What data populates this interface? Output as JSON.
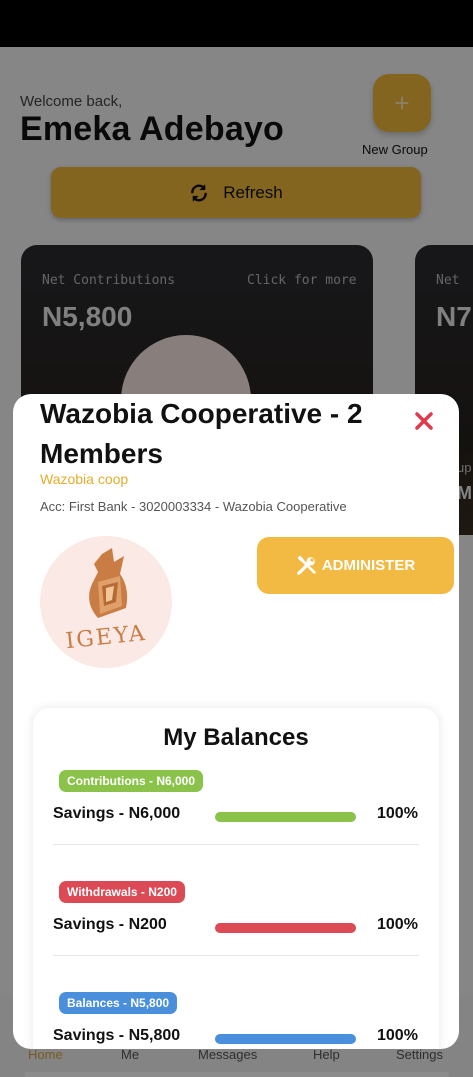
{
  "home": {
    "welcome_text": "Welcome back,",
    "user_name": "Emeka Adebayo",
    "new_group_label": "New Group",
    "refresh_label": "Refresh",
    "cards": [
      {
        "label": "Net Contributions",
        "more": "Click for more",
        "amount": "N5,800"
      },
      {
        "label": "Net",
        "amount": "N7",
        "extra1": "up",
        "extra2": "M"
      }
    ]
  },
  "bottom_nav": {
    "items": [
      "Home",
      "Me",
      "Messages",
      "Help",
      "Settings"
    ]
  },
  "modal": {
    "title": "Wazobia Cooperative - 2 Members",
    "subtitle": "Wazobia coop",
    "account": "Acc: First Bank - 3020003334 - Wazobia Cooperative",
    "logo_text": "IGEYA",
    "administer_label": "ADMINISTER",
    "balances": {
      "title": "My Balances",
      "rows": [
        {
          "badge": "Contributions - N6,000",
          "label": "Savings - N6,000",
          "percent": "100%",
          "progress": 1.0,
          "color": "#8bc34a"
        },
        {
          "badge": "Withdrawals - N200",
          "label": "Savings - N200",
          "percent": "100%",
          "progress": 1.0,
          "color": "#dc4a56"
        },
        {
          "badge": "Balances - N5,800",
          "label": "Savings - N5,800",
          "percent": "100%",
          "progress": 1.0,
          "color": "#4a8fdc"
        }
      ]
    }
  },
  "colors": {
    "accent": "#f0b93a",
    "close": "#e03a4a"
  }
}
